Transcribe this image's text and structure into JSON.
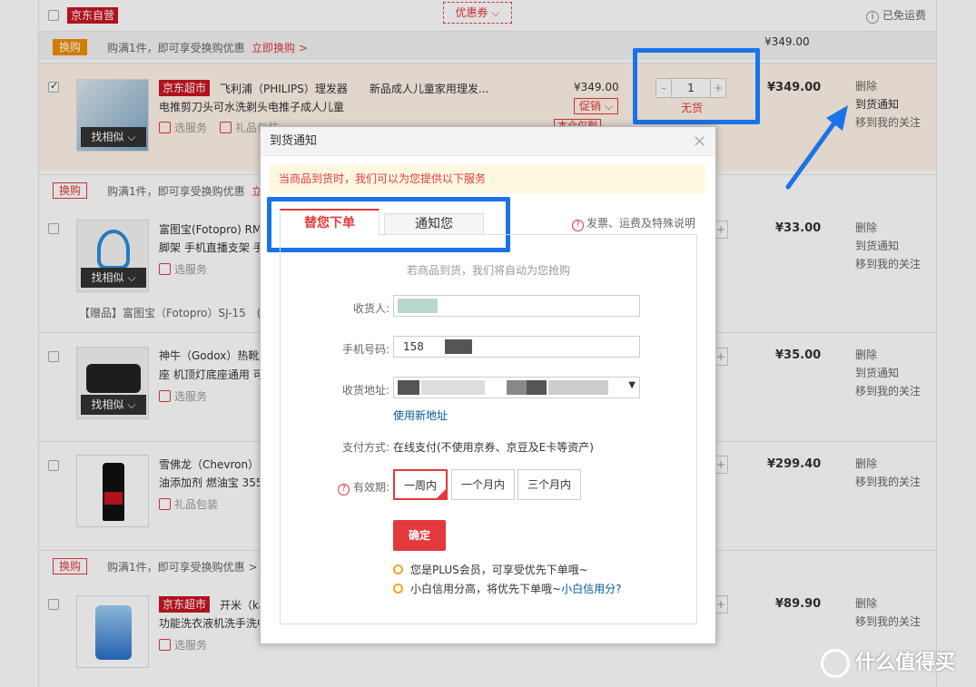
{
  "header": {
    "self_run_tag": "京东自营",
    "coupon_label": "优惠券",
    "free_shipping": "已免运费"
  },
  "groups": [
    {
      "swap_tag": "换购",
      "swap_text": "购满1件，即可享受换购优惠",
      "swap_link": "立即换购 >",
      "subtotal": "¥349.00"
    },
    {
      "swap_tag": "换购",
      "swap_text": "购满1件，即可享受换购优惠",
      "swap_link": "立"
    },
    {
      "swap_tag": "换购",
      "swap_text": "购满1件，即可享受换购优惠 >"
    }
  ],
  "items": [
    {
      "tag": "京东超市",
      "title": "飞利浦（PHILIPS）理发器　　新品成人儿童家用理发...",
      "title2": "电推剪刀头可水洗剃头电推子成人儿童",
      "service": "选服务",
      "gift": "礼品包装",
      "price": "¥349.00",
      "promo": "促销",
      "promo_extra": "本仓仅剩",
      "qty": "1",
      "stock": "无货",
      "total": "¥349.00",
      "ops": [
        "删除",
        "到货通知",
        "移到我的关注"
      ],
      "find_similar": "找相似"
    },
    {
      "title": "富图宝(Fotopro) RM",
      "title2": "脚架 手机直播支架 手",
      "service": "选服务",
      "gift_line": "【赠品】富图宝（Fotopro）SJ-15　(",
      "total": "¥33.00",
      "ops": [
        "删除",
        "到货通知",
        "移到我的关注"
      ],
      "find_similar": "找相似"
    },
    {
      "title": "神牛（Godox）热靴",
      "title2": "座 机顶灯底座通用 可",
      "service": "选服务",
      "total": "¥35.00",
      "ops": [
        "删除",
        "到货通知",
        "移到我的关注"
      ],
      "find_similar": "找相似"
    },
    {
      "title": "雪佛龙（Chevron）",
      "title2": "油添加剂 燃油宝 355",
      "gift": "礼品包装",
      "total": "¥299.40",
      "ops": [
        "删除",
        "移到我的关注"
      ]
    },
    {
      "tag": "京东超市",
      "title": "开米（ka",
      "title2": "功能洗衣液机洗手洗中",
      "service": "选服务",
      "total": "¥89.90",
      "ops": [
        "删除",
        "移到我的关注"
      ]
    }
  ],
  "dialog": {
    "title": "到货通知",
    "notice": "当商品到货时，我们可以为您提供以下服务",
    "tabs": [
      "替您下单",
      "通知您"
    ],
    "help_link": "发票、运费及特殊说明",
    "intro": "若商品到货，我们将自动为您抢购",
    "receiver_label": "收货人:",
    "phone_label": "手机号码:",
    "phone_value": "158",
    "address_label": "收货地址:",
    "new_address": "使用新地址",
    "pay_label": "支付方式:",
    "pay_value": "在线支付(不使用京券、京豆及E卡等资产)",
    "validity_label": "有效期:",
    "validity_options": [
      "一周内",
      "一个月内",
      "三个月内"
    ],
    "confirm": "确定",
    "tip1": "您是PLUS会员，可享受优先下单哦~",
    "tip2": "小白信用分高，将优先下单哦~",
    "tip2_link": "小白信用分?"
  },
  "watermark": "什么值得买",
  "colors": {
    "brand_red": "#e4393c",
    "highlight_blue": "#1a73e8",
    "notice_bg": "#fff8e1"
  }
}
